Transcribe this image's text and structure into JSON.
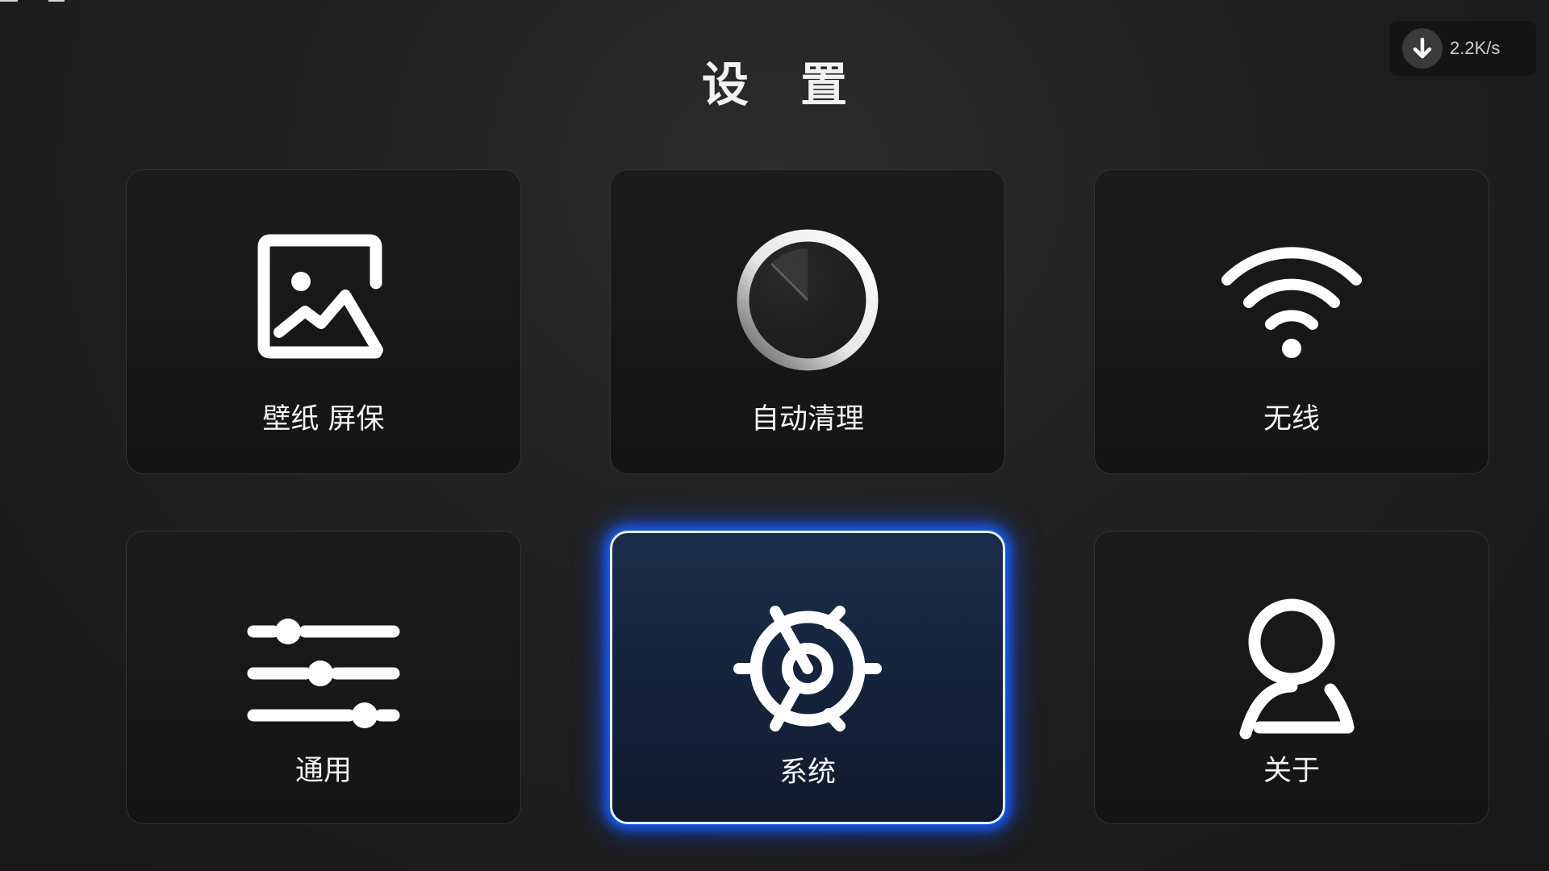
{
  "header": {
    "title": "设 置",
    "download_speed": "2.2K/s",
    "download_icon": "arrow-down-icon"
  },
  "tiles": [
    {
      "label": "壁纸 屏保",
      "icon": "image-icon"
    },
    {
      "label": "自动清理",
      "icon": "cleanup-dial-icon"
    },
    {
      "label": "无线",
      "icon": "wifi-icon"
    },
    {
      "label": "通用",
      "icon": "sliders-icon"
    },
    {
      "label": "系统",
      "icon": "system-gear-icon",
      "focused": true
    },
    {
      "label": "关于",
      "icon": "user-icon"
    }
  ],
  "colors": {
    "background": "#1f1f1f",
    "tile": "#161616",
    "focus_glow": "#1660ff",
    "focus_fill": "#1b2d4a",
    "text": "#ffffff"
  }
}
